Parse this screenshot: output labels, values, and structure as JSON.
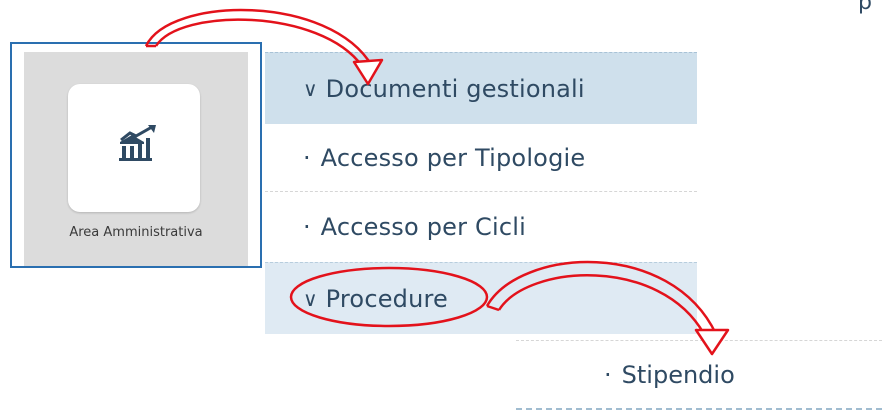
{
  "top_fragment": "p",
  "tile": {
    "icon": "bank-chart-icon",
    "label": "Area Amministrativa"
  },
  "menu": {
    "docs": {
      "chevron": "∨",
      "label": "Documenti gestionali"
    },
    "tipologie": {
      "bullet": "·",
      "label": "Accesso per Tipologie"
    },
    "cicli": {
      "bullet": "·",
      "label": "Accesso per Cicli"
    },
    "procedure": {
      "chevron": "∨",
      "label": "Procedure"
    },
    "stipendio": {
      "bullet": "·",
      "label": "Stipendio"
    }
  },
  "colors": {
    "text": "#2f4a63",
    "row_active": "#cfe0ec",
    "row_hover": "#dfeaf3",
    "annotation": "#e3121b",
    "tile_border": "#2a6fb0"
  }
}
